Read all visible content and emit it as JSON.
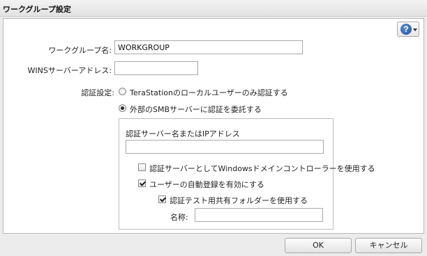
{
  "window": {
    "title": "ワークグループ設定"
  },
  "help": {
    "icon": "help-question-icon"
  },
  "workgroup": {
    "label": "ワークグループ名:",
    "value": "WORKGROUP"
  },
  "wins": {
    "label": "WINSサーバーアドレス:",
    "value": ""
  },
  "auth": {
    "label": "認証設定:",
    "options": [
      {
        "label": "TeraStationのローカルユーザーのみ認証する",
        "selected": false
      },
      {
        "label": "外部のSMBサーバーに認証を委託する",
        "selected": true
      }
    ],
    "server": {
      "label": "認証サーバー名またはIPアドレス",
      "value": ""
    },
    "use_domain_controller": {
      "label": "認証サーバーとしてWindowsドメインコントローラーを使用する",
      "checked": false
    },
    "auto_register": {
      "label": "ユーザーの自動登録を有効にする",
      "checked": true
    },
    "test_share": {
      "label": "認証テスト用共有フォルダーを使用する",
      "checked": true
    },
    "share_name": {
      "label": "名称:",
      "value": ""
    }
  },
  "buttons": {
    "ok": "OK",
    "cancel": "キャンセル"
  }
}
